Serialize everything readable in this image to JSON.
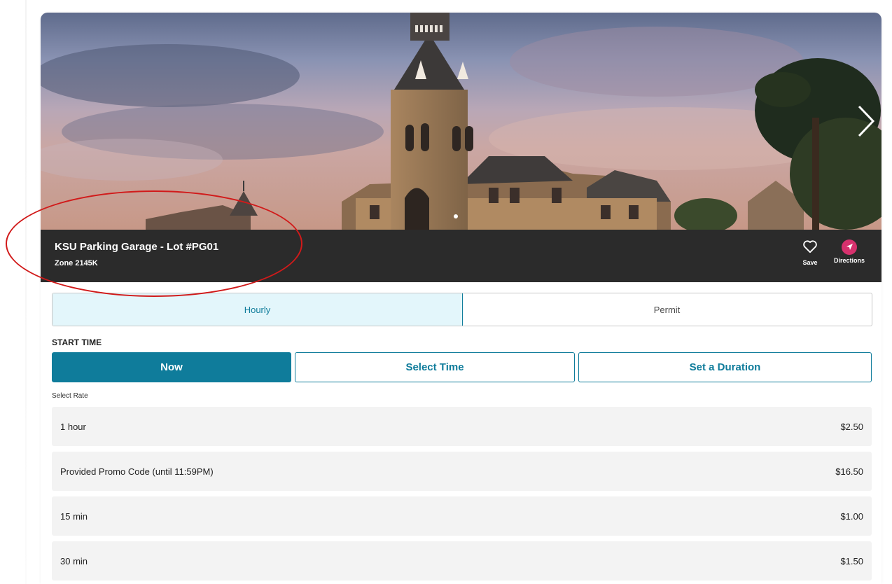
{
  "lot": {
    "name": "KSU Parking Garage - Lot #PG01",
    "zone": "Zone 2145K"
  },
  "actions": {
    "save_label": "Save",
    "directions_label": "Directions"
  },
  "tabs": [
    {
      "label": "Hourly",
      "active": true
    },
    {
      "label": "Permit",
      "active": false
    }
  ],
  "start_time": {
    "label": "START TIME",
    "options": [
      {
        "label": "Now",
        "active": true
      },
      {
        "label": "Select Time",
        "active": false
      },
      {
        "label": "Set a Duration",
        "active": false
      }
    ]
  },
  "rates": {
    "label": "Select Rate",
    "items": [
      {
        "name": "1 hour",
        "price": "$2.50"
      },
      {
        "name": "Provided Promo Code (until 11:59PM)",
        "price": "$16.50"
      },
      {
        "name": "15 min",
        "price": "$1.00"
      },
      {
        "name": "30 min",
        "price": "$1.50"
      }
    ]
  },
  "carousel": {
    "slide_count": 1,
    "active_slide": 1
  },
  "colors": {
    "accent": "#0f7c9b",
    "directions": "#d6316d",
    "title_bar": "#2b2b2b",
    "annotation": "#d11a1a"
  },
  "icons": [
    "heart-icon",
    "navigation-arrow-icon",
    "chevron-right-icon"
  ]
}
